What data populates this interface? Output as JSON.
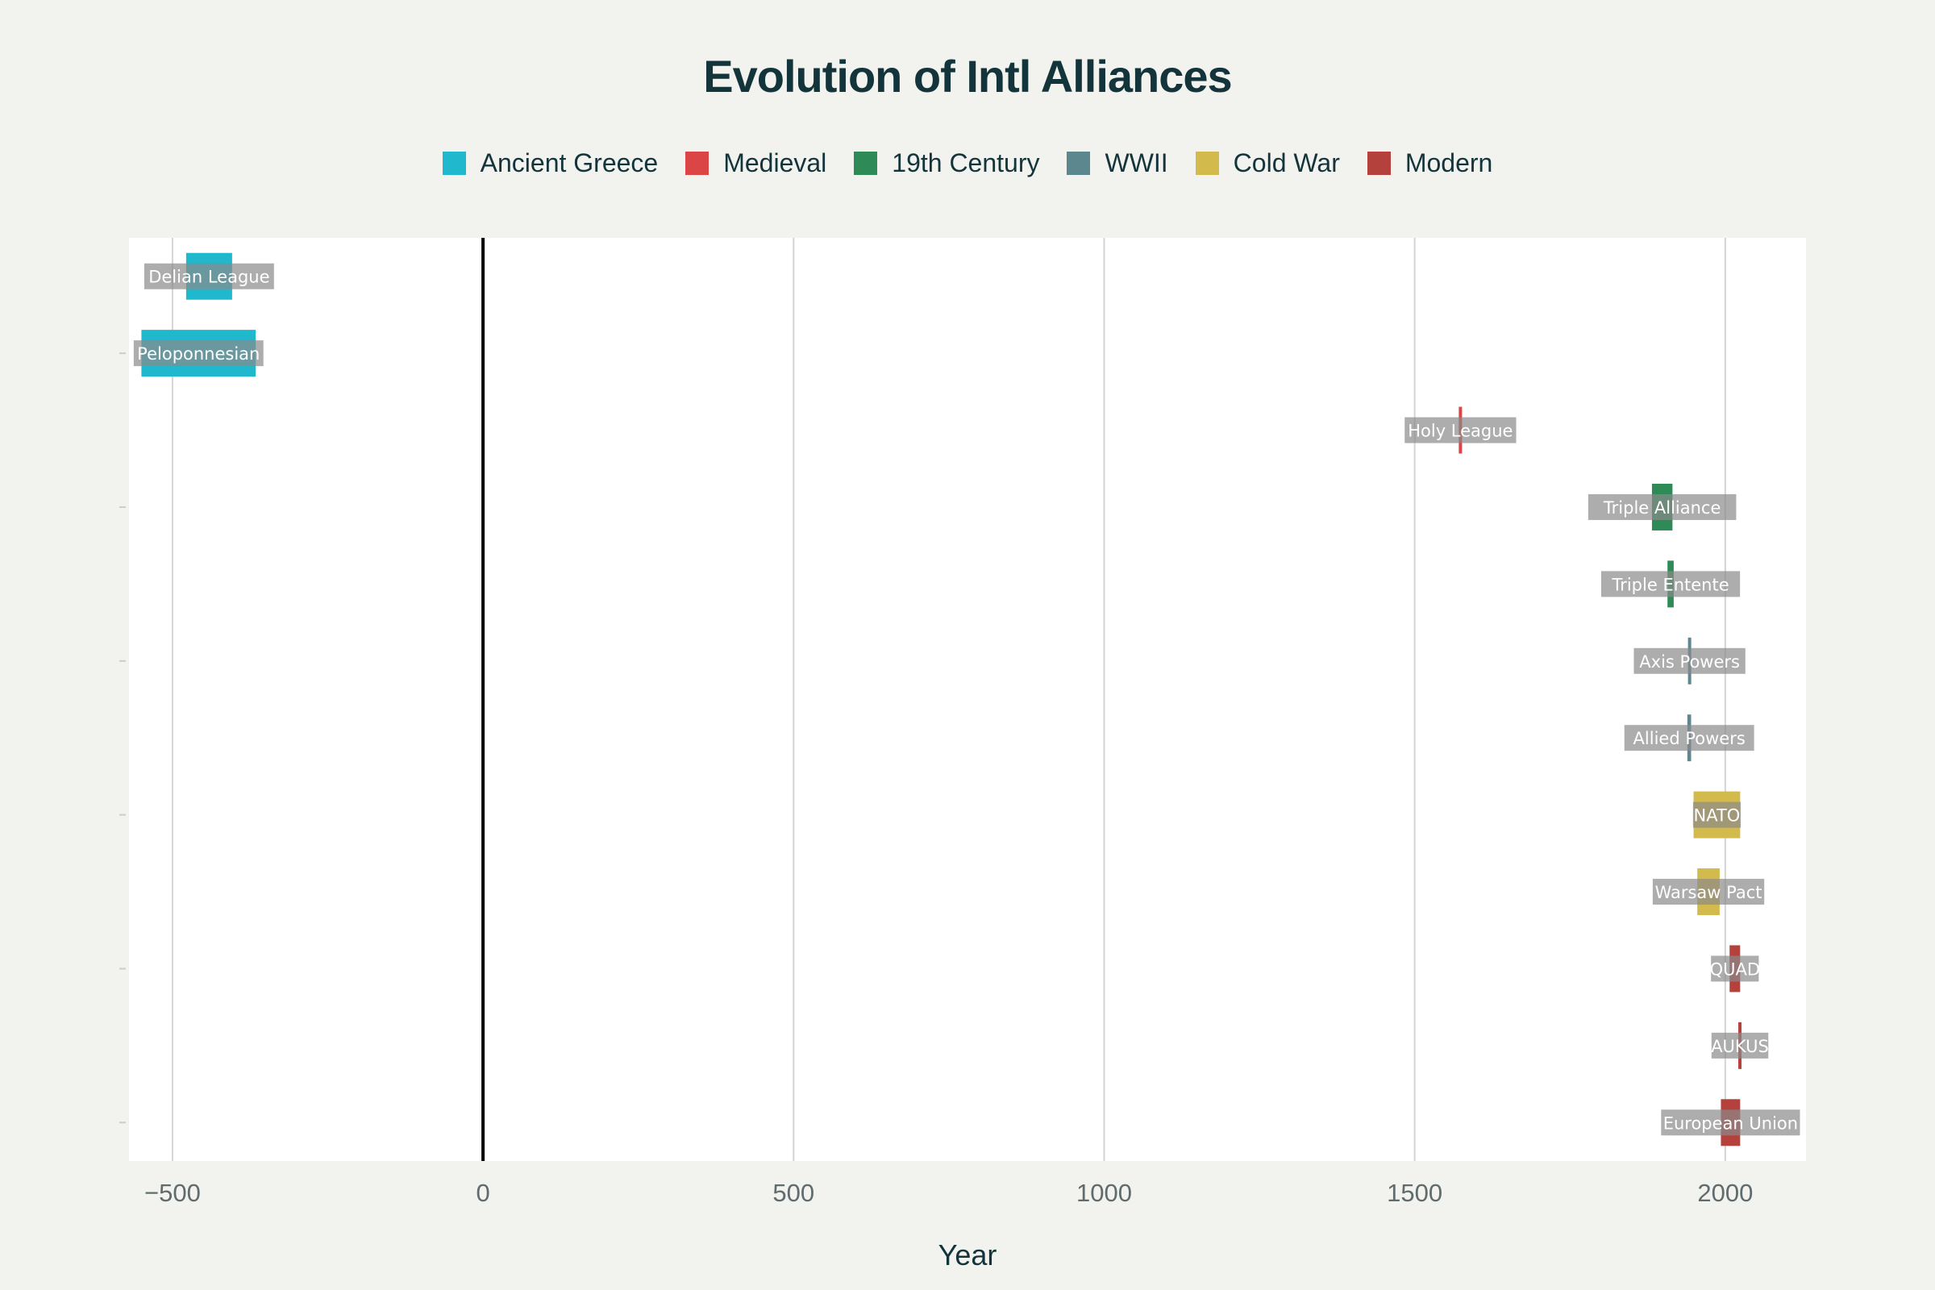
{
  "chart_data": {
    "type": "bar",
    "orientation": "horizontal",
    "title": "Evolution of Intl Alliances",
    "xlabel": "Year",
    "ylabel": "",
    "xlim": [
      -570,
      2130
    ],
    "xticks": [
      -500,
      0,
      500,
      1000,
      1500,
      2000
    ],
    "xtick_labels": [
      "−500",
      "0",
      "500",
      "1000",
      "1500",
      "2000"
    ],
    "grid": true,
    "legend_position": "top",
    "series": [
      {
        "name": "Ancient Greece",
        "color": "#1fb8cd"
      },
      {
        "name": "Medieval",
        "color": "#db4545"
      },
      {
        "name": "19th Century",
        "color": "#2e8b57"
      },
      {
        "name": "WWII",
        "color": "#5d878f"
      },
      {
        "name": "Cold War",
        "color": "#d2ba4c"
      },
      {
        "name": "Modern",
        "color": "#b4413c"
      }
    ],
    "bars": [
      {
        "label": "Delian League",
        "start": -478,
        "end": -404,
        "series": "Ancient Greece"
      },
      {
        "label": "Peloponnesian",
        "start": -550,
        "end": -366,
        "series": "Ancient Greece"
      },
      {
        "label": "Holy League",
        "start": 1571,
        "end": 1573,
        "series": "Medieval"
      },
      {
        "label": "Triple Alliance",
        "start": 1882,
        "end": 1915,
        "series": "19th Century"
      },
      {
        "label": "Triple Entente",
        "start": 1907,
        "end": 1917,
        "series": "19th Century"
      },
      {
        "label": "Axis Powers",
        "start": 1940,
        "end": 1945,
        "series": "WWII"
      },
      {
        "label": "Allied Powers",
        "start": 1939,
        "end": 1945,
        "series": "WWII"
      },
      {
        "label": "NATO",
        "start": 1949,
        "end": 2024,
        "series": "Cold War"
      },
      {
        "label": "Warsaw Pact",
        "start": 1955,
        "end": 1991,
        "series": "Cold War"
      },
      {
        "label": "QUAD",
        "start": 2007,
        "end": 2024,
        "series": "Modern"
      },
      {
        "label": "AUKUS",
        "start": 2021,
        "end": 2024,
        "series": "Modern"
      },
      {
        "label": "European Union",
        "start": 1993,
        "end": 2024,
        "series": "Modern"
      }
    ]
  }
}
